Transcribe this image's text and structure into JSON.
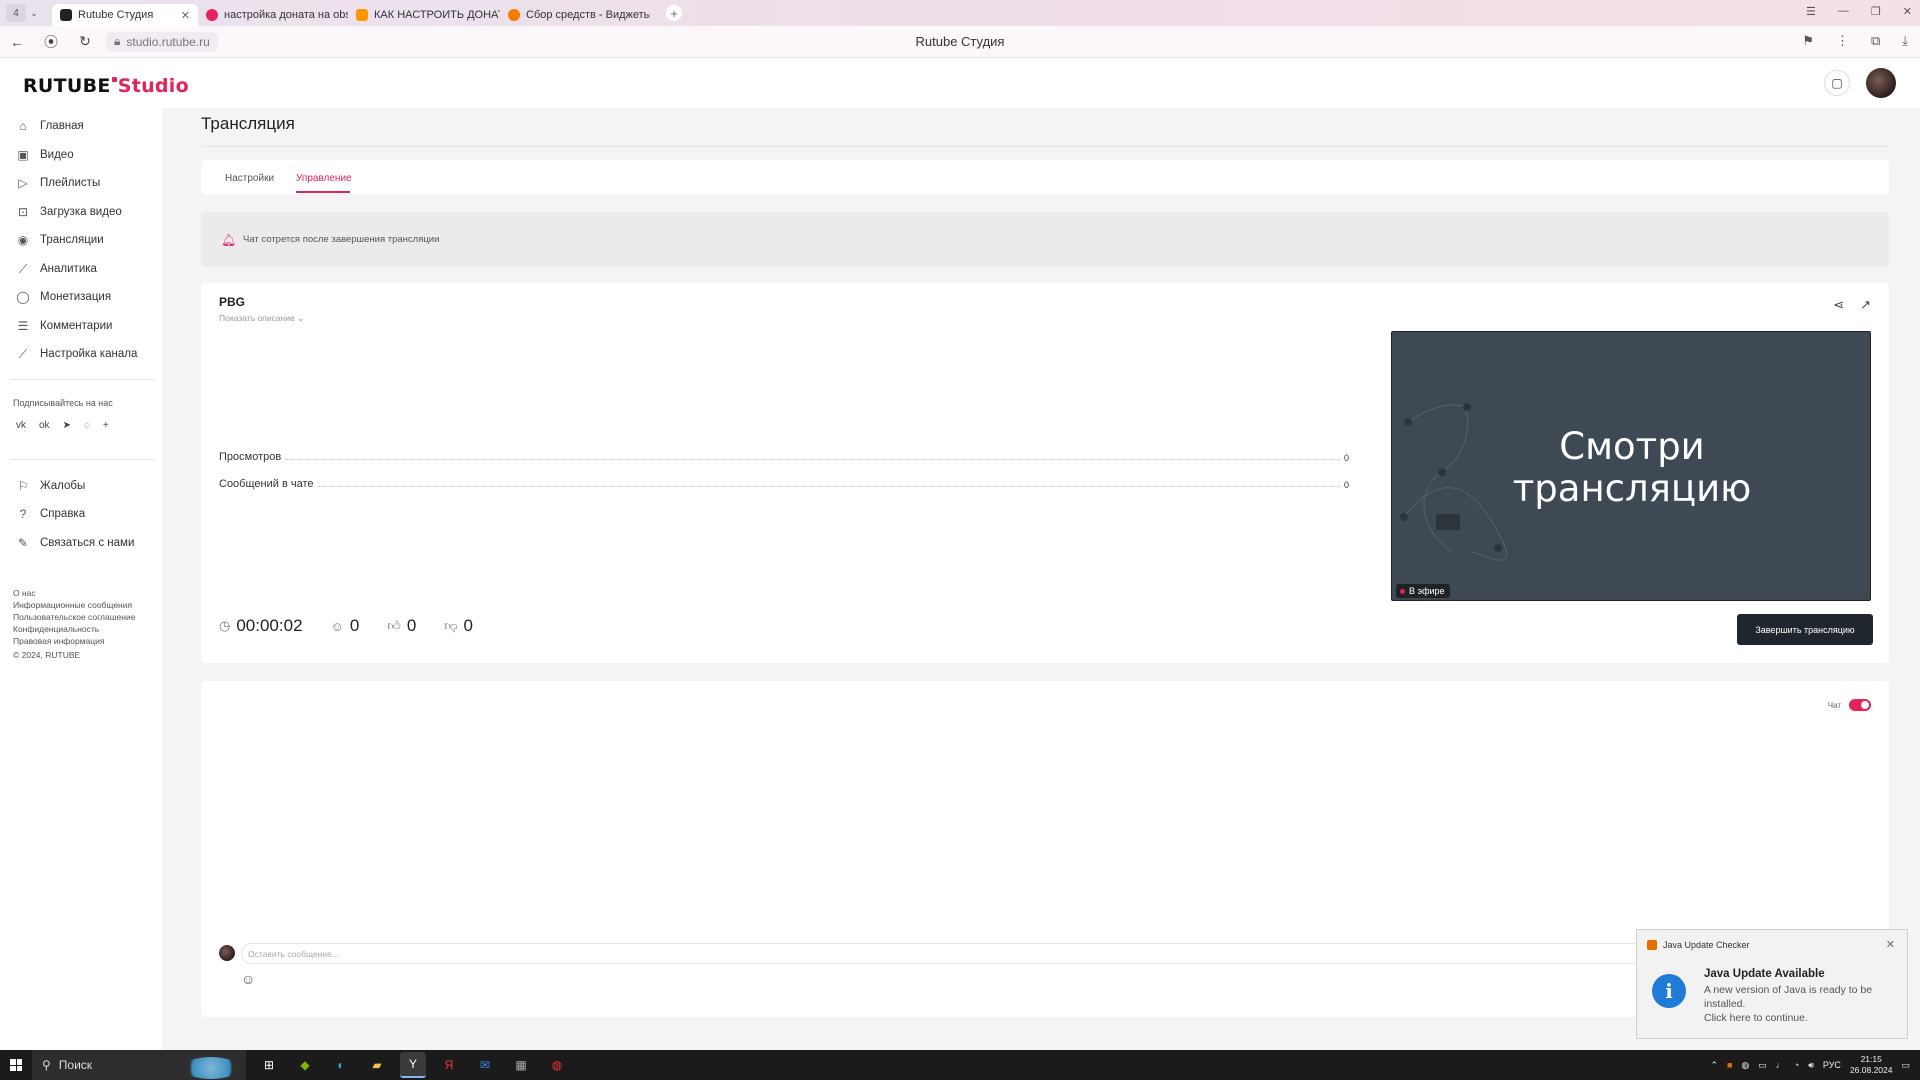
{
  "browser": {
    "tab_count": "4",
    "tabs": [
      {
        "label": "Rutube Студия",
        "color": "#222222"
      },
      {
        "label": "настройка доната на obs",
        "color": "#e2235c"
      },
      {
        "label": "КАК НАСТРОИТЬ ДОНАТ",
        "color": "#ff9800"
      },
      {
        "label": "Сбор средств - Виджеты",
        "color": "#f57c00"
      }
    ],
    "url": "studio.rutube.ru",
    "page_title": "Rutube Студия"
  },
  "app": {
    "logo_main": "RUTUBE",
    "logo_studio": "Studio",
    "brand_color": "#e2235c"
  },
  "sidebar": {
    "items": [
      {
        "label": "Главная",
        "icon": "home-icon"
      },
      {
        "label": "Видео",
        "icon": "video-icon"
      },
      {
        "label": "Плейлисты",
        "icon": "playlist-icon"
      },
      {
        "label": "Загрузка видео",
        "icon": "upload-icon"
      },
      {
        "label": "Трансляции",
        "icon": "broadcast-icon"
      },
      {
        "label": "Аналитика",
        "icon": "analytics-icon"
      },
      {
        "label": "Монетизация",
        "icon": "coin-icon"
      },
      {
        "label": "Комментарии",
        "icon": "comments-icon"
      },
      {
        "label": "Настройка канала",
        "icon": "wand-icon"
      }
    ],
    "follow_label": "Подписывайтесь на нас",
    "secondary": [
      {
        "label": "Жалобы",
        "icon": "flag-icon"
      },
      {
        "label": "Справка",
        "icon": "help-icon"
      },
      {
        "label": "Связаться с нами",
        "icon": "pen-icon"
      }
    ],
    "footer_links": [
      "О нас",
      "Информационные сообщения",
      "Пользовательское соглашение",
      "Конфиденциальность",
      "Правовая информация"
    ],
    "copyright": "© 2024, RUTUBE"
  },
  "page": {
    "title": "Трансляция",
    "tabs": [
      "Настройки",
      "Управление"
    ],
    "notice": "Чат сотрется после завершения трансляции"
  },
  "stream": {
    "name": "PBG",
    "show_description": "Показать описание",
    "stats": [
      {
        "label": "Просмотров",
        "value": "0"
      },
      {
        "label": "Сообщений в чате",
        "value": "0"
      }
    ],
    "duration": "00:00:02",
    "viewers": "0",
    "likes": "0",
    "dislikes": "0",
    "preview_text_line1": "Смотри",
    "preview_text_line2": "трансляцию",
    "live_label": "В эфире",
    "end_button": "Завершить трансляцию"
  },
  "chat": {
    "toggle_label": "Чат",
    "enabled": true,
    "input_placeholder": "Оставить сообщение..."
  },
  "toast": {
    "app": "Java Update Checker",
    "title": "Java Update Available",
    "body": "A new version of Java is ready to be installed.",
    "link": "Click here to continue."
  },
  "taskbar": {
    "search_label": "Поиск",
    "lang": "РУС",
    "time": "21:15",
    "date": "26.08.2024"
  }
}
